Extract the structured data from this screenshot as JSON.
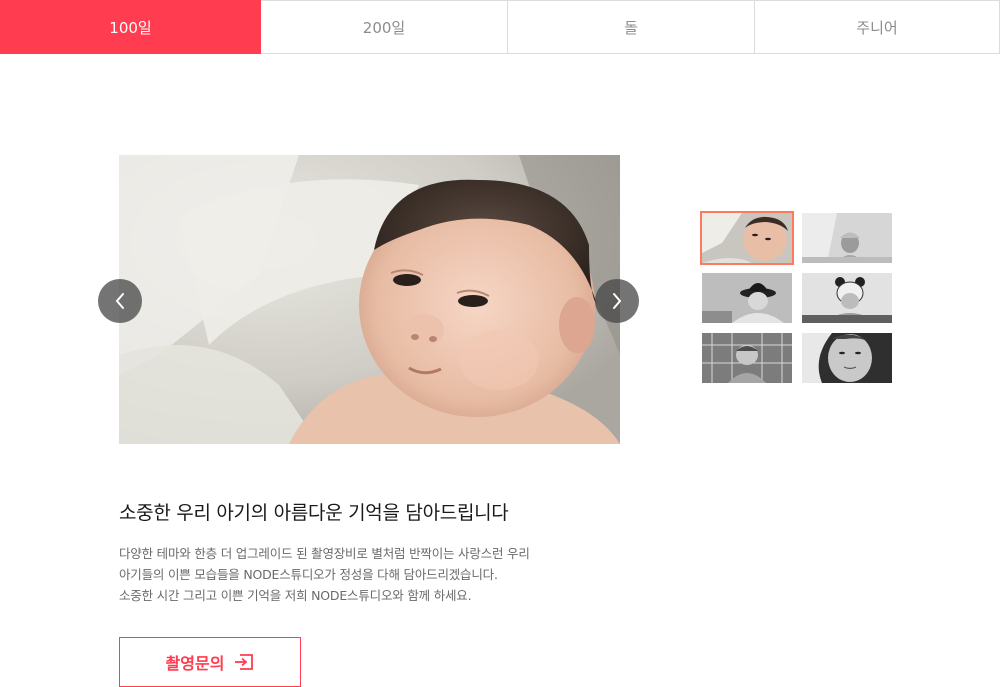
{
  "tabs": [
    {
      "label": "100일",
      "active": true
    },
    {
      "label": "200일",
      "active": false
    },
    {
      "label": "돌",
      "active": false
    },
    {
      "label": "주니어",
      "active": false
    }
  ],
  "gallery": {
    "thumbnail_count": 6,
    "selected_index": 0
  },
  "content": {
    "headline": "소중한 우리 아기의 아름다운 기억을 담아드립니다",
    "description": [
      "다양한 테마와 한층 더 업그레이드 된 촬영장비로 별처럼 반짝이는 사랑스런 우리",
      "아기들의 이쁜 모습들을 NODE스튜디오가 정성을 다해 담아드리겠습니다.",
      "소중한 시간 그리고 이쁜 기억을 저희 NODE스튜디오와 함께 하세요."
    ],
    "cta_label": "촬영문의"
  },
  "colors": {
    "accent": "#ff3c50",
    "thumb_active_border": "#ff7a5c"
  },
  "icons": {
    "prev": "chevron-left-icon",
    "next": "chevron-right-icon",
    "cta": "enter-icon"
  }
}
